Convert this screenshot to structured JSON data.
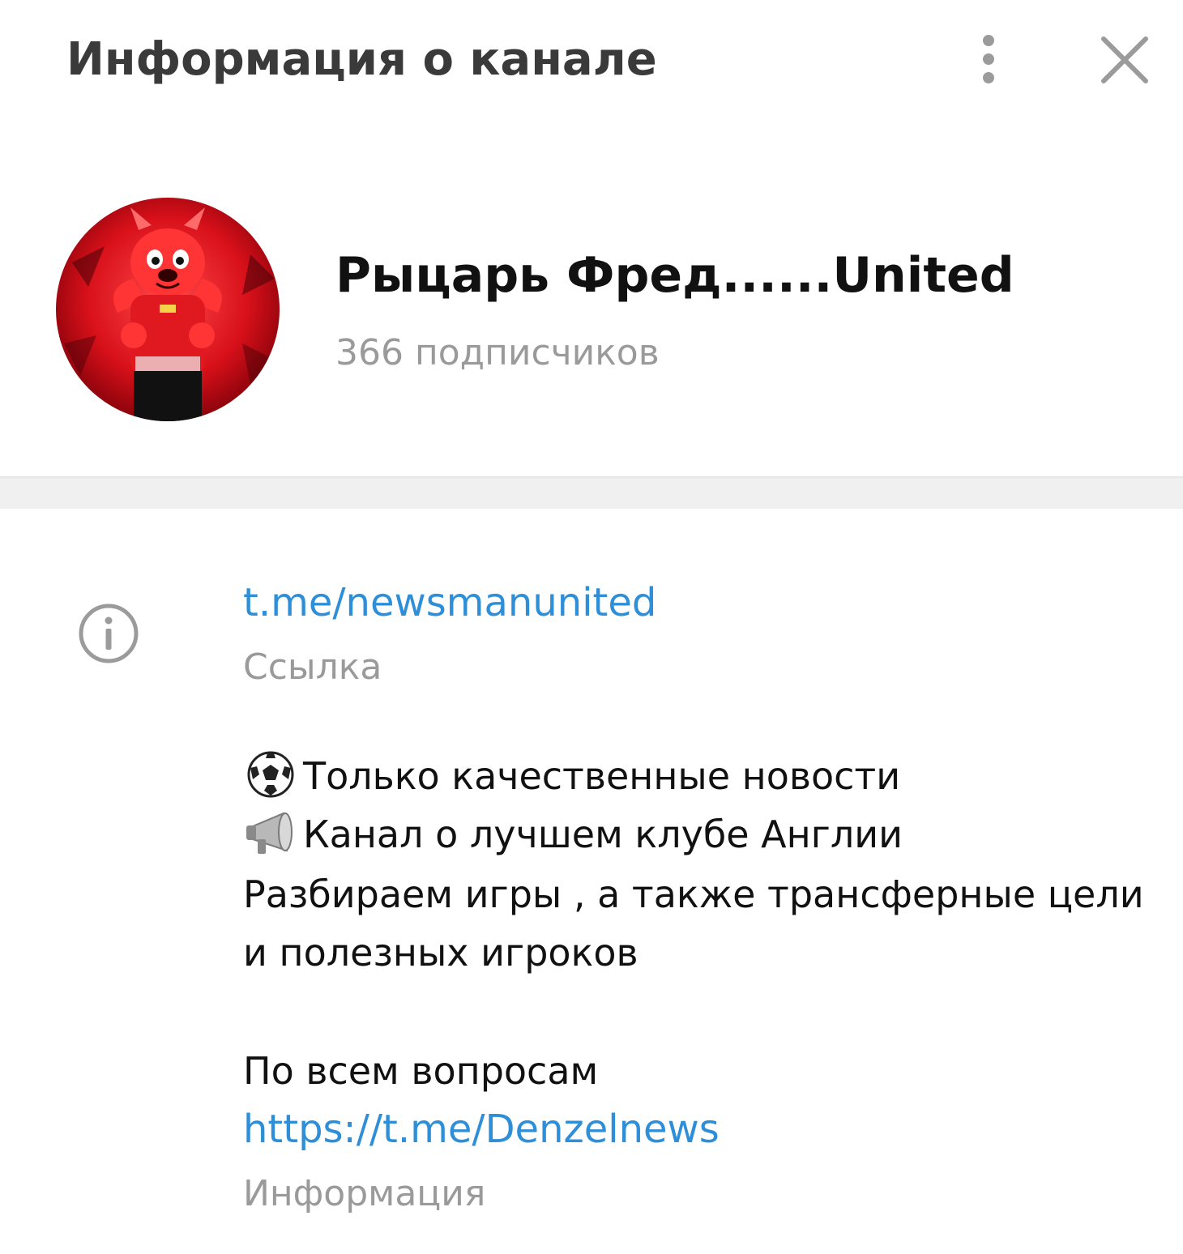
{
  "header": {
    "title": "Информация о канале",
    "menu_icon": "more-vertical-icon",
    "close_icon": "close-icon"
  },
  "profile": {
    "name": "Рыцарь Фред......United",
    "subscribers": "366 подписчиков"
  },
  "info": {
    "icon": "info-icon",
    "link": "t.me/newsmanunited",
    "link_caption": "Ссылка",
    "description_lines": [
      "Только качественные новости",
      "Канал о лучшем клубе Англии",
      "Разбираем игры , а также трансферные цели",
      "и полезных игроков",
      "По всем вопросам"
    ],
    "description_link": "https://t.me/Denzelnews",
    "description_caption": "Информация"
  },
  "colors": {
    "link": "#2e8fd8",
    "muted": "#9a9a9a",
    "title": "#3a3a3a",
    "divider": "#f0f0f0"
  }
}
